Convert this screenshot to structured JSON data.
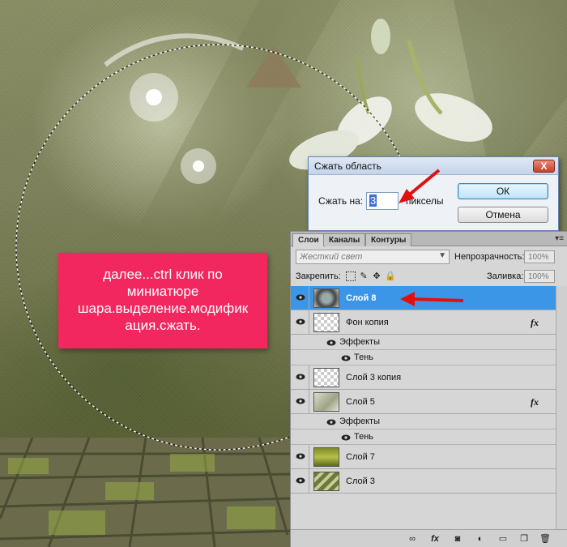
{
  "annotation": {
    "line1": "далее...ctrl клик по",
    "line2": "миниатюре",
    "line3": "шара.выделение.модифик",
    "line4": "ация.сжать."
  },
  "dialog": {
    "title": "Сжать область",
    "contract_label": "Сжать на:",
    "contract_value": "3",
    "unit": "пикселы",
    "ok_label": "ОК",
    "cancel_label": "Отмена",
    "close_label": "X"
  },
  "layers_panel": {
    "tabs": [
      "Слои",
      "Каналы",
      "Контуры"
    ],
    "blend_mode": "Жесткий свет",
    "opacity_label": "Непрозрачность:",
    "opacity_value": "100%",
    "lock_label": "Закрепить:",
    "fill_label": "Заливка:",
    "fill_value": "100%",
    "fx_label": "fx",
    "effects_label": "Эффекты",
    "shadow_label": "Тень",
    "layers": [
      {
        "name": "Слой 8",
        "selected": true,
        "fx": false
      },
      {
        "name": "Фон копия",
        "selected": false,
        "fx": true,
        "effects": [
          "Тень"
        ]
      },
      {
        "name": "Слой 3 копия",
        "selected": false,
        "fx": false
      },
      {
        "name": "Слой 5",
        "selected": false,
        "fx": true,
        "effects": [
          "Тень"
        ]
      },
      {
        "name": "Слой 7",
        "selected": false,
        "fx": false
      },
      {
        "name": "Слой 3",
        "selected": false,
        "fx": false
      }
    ]
  },
  "colors": {
    "note_bg": "#f2275f",
    "selection": "#3b96e8",
    "arrow": "#e01010"
  }
}
